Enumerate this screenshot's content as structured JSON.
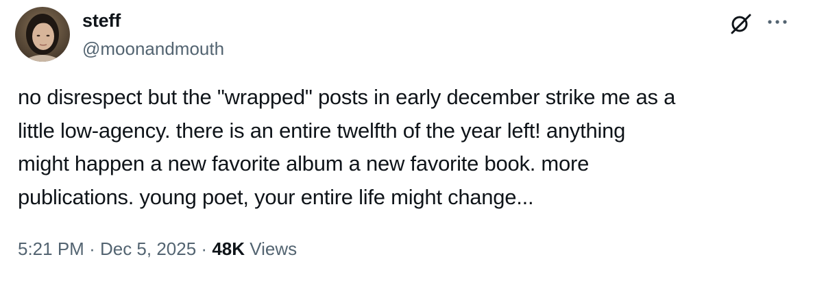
{
  "author": {
    "display_name": "steff",
    "handle": "@moonandmouth"
  },
  "icons": {
    "grok": "grok-icon",
    "more": "more-options-icon"
  },
  "tweet": {
    "text": "no disrespect but the \"wrapped\" posts in early december strike me as a\nlittle low-agency. there is an entire twelfth of the year left! anything\nmight happen a new favorite album a new favorite book. more\npublications. young poet, your entire life might change..."
  },
  "meta": {
    "time": "5:21 PM",
    "separator": "·",
    "date": "Dec 5, 2025",
    "views_count": "48K",
    "views_label": "Views"
  },
  "colors": {
    "text_primary": "#0f1419",
    "text_secondary": "#536471",
    "background": "#ffffff"
  }
}
